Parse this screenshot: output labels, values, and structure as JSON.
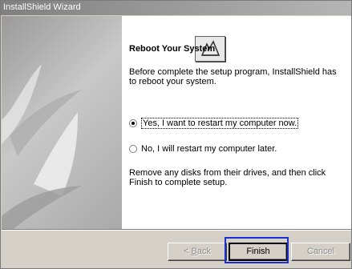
{
  "window": {
    "title": "InstallShield Wizard"
  },
  "content": {
    "heading": "Reboot Your System",
    "intro": "Before complete the setup program, InstallShield has to reboot your system.",
    "options": [
      {
        "label": "Yes, I want to restart my computer now.",
        "selected": true
      },
      {
        "label": "No, I will restart my computer later.",
        "selected": false
      }
    ],
    "instructions": "Remove any disks from their drives, and then click Finish to complete setup."
  },
  "buttons": {
    "back": {
      "label_prefix": "< ",
      "accel": "B",
      "label_rest": "ack",
      "enabled": false
    },
    "finish": {
      "label": "Finish",
      "enabled": true,
      "default": true
    },
    "cancel": {
      "label": "Cancel",
      "enabled": false
    }
  },
  "colors": {
    "highlight": "#1a2fd0",
    "titlebar_start": "#808080",
    "dialog_bg": "#d4d0c8"
  },
  "icons": {
    "logo": "installshield-logo-icon"
  }
}
